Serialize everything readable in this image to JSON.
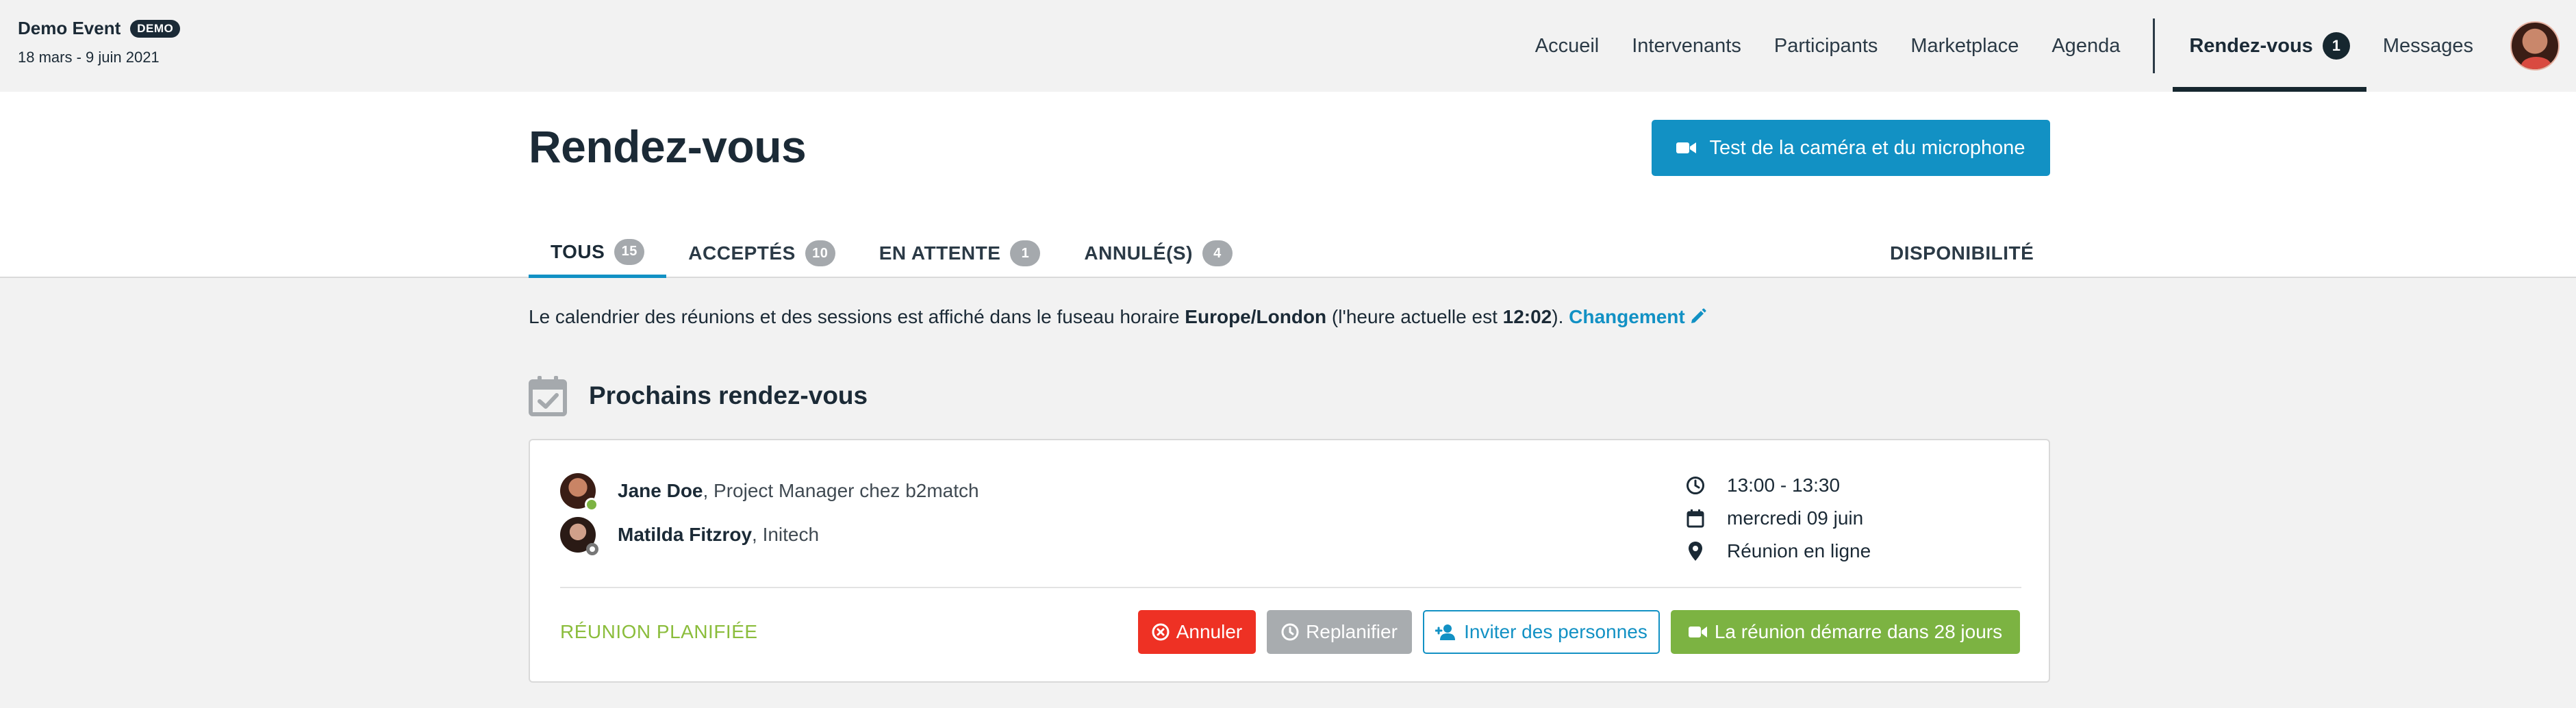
{
  "event": {
    "title": "Demo Event",
    "badge": "DEMO",
    "dates": "18 mars - 9 juin 2021"
  },
  "nav": {
    "items": [
      {
        "label": "Accueil"
      },
      {
        "label": "Intervenants"
      },
      {
        "label": "Participants"
      },
      {
        "label": "Marketplace"
      },
      {
        "label": "Agenda"
      }
    ],
    "active": {
      "label": "Rendez-vous",
      "count": "1"
    },
    "messages": "Messages"
  },
  "page": {
    "title": "Rendez-vous",
    "camera_button": "Test de la caméra et du microphone"
  },
  "tabs": [
    {
      "label": "TOUS",
      "count": "15"
    },
    {
      "label": "ACCEPTÉS",
      "count": "10"
    },
    {
      "label": "EN ATTENTE",
      "count": "1"
    },
    {
      "label": "ANNULÉ(S)",
      "count": "4"
    }
  ],
  "availability": "DISPONIBILITÉ",
  "timezone": {
    "prefix": "Le calendrier des réunions et des sessions est affiché dans le fuseau horaire ",
    "zone": "Europe/London",
    "middle": " (l'heure actuelle est ",
    "time": "12:02",
    "suffix": "). ",
    "change": "Changement"
  },
  "section": {
    "title": "Prochains rendez-vous"
  },
  "meeting": {
    "participants": [
      {
        "name": "Jane Doe",
        "detail": ", Project Manager chez b2match",
        "status": "online"
      },
      {
        "name": "Matilda Fitzroy",
        "detail": ", Initech",
        "status": "offline"
      }
    ],
    "time": "13:00 - 13:30",
    "date": "mercredi 09 juin",
    "location": "Réunion en ligne",
    "status": "RÉUNION PLANIFIÉE",
    "actions": {
      "cancel": "Annuler",
      "reschedule": "Replanifier",
      "invite": "Inviter des personnes",
      "start": "La réunion démarre dans 28 jours"
    }
  },
  "colors": {
    "accent": "#1291c4",
    "success": "#7cb342",
    "danger": "#ee3124",
    "muted": "#a8acaf",
    "dark": "#1b2a36"
  }
}
